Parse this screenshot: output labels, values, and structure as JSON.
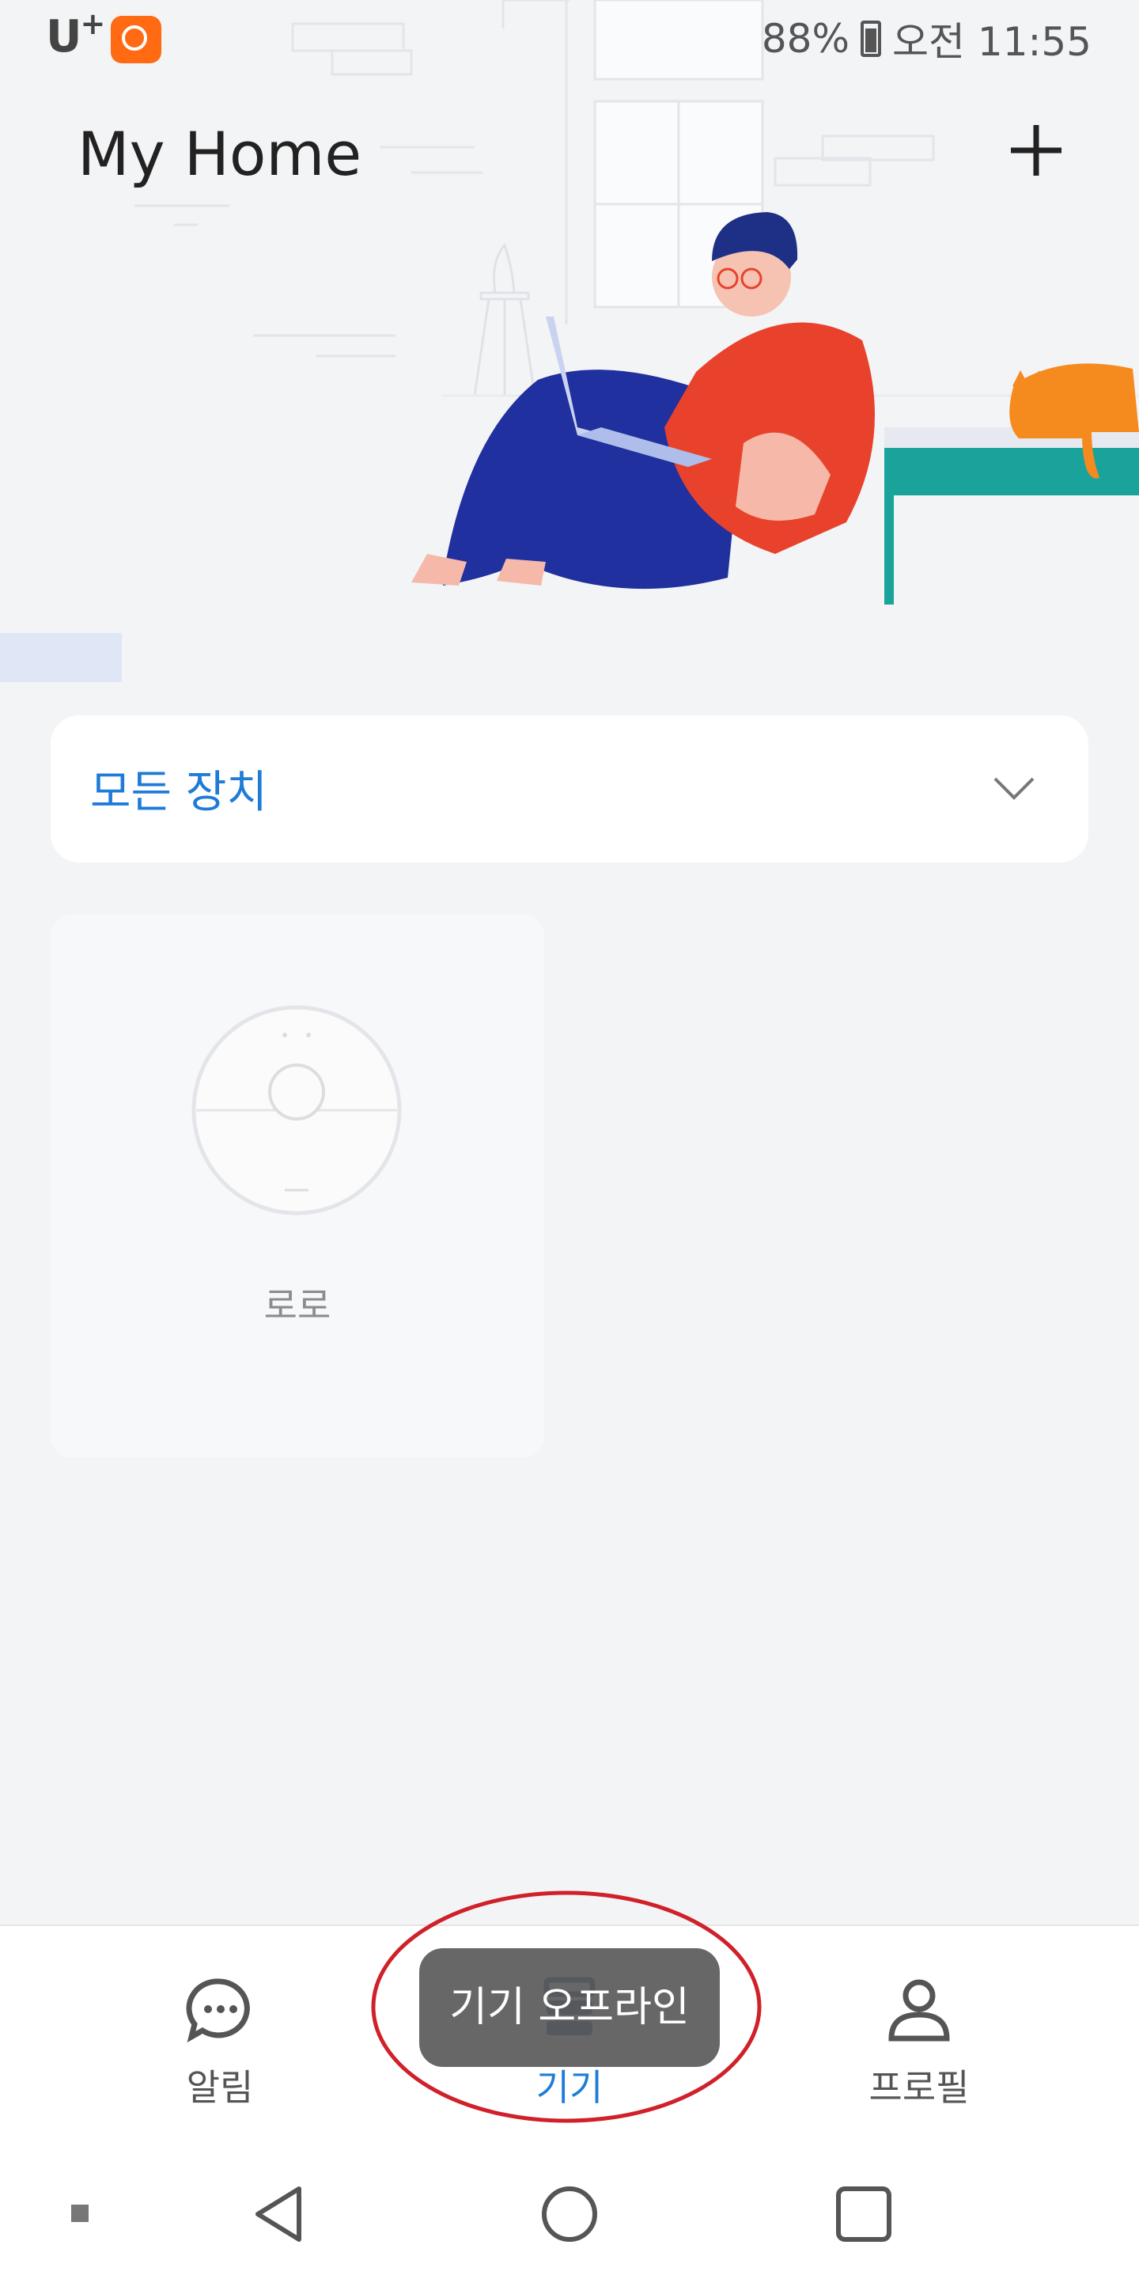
{
  "status_bar": {
    "carrier": "U",
    "carrier_sup": "+",
    "battery": "88%",
    "time": "오전 11:55",
    "icons": [
      "xiaomi-home-app-icon",
      "bluetooth-icon",
      "lte-icon",
      "signal-icon",
      "battery-icon"
    ]
  },
  "header": {
    "title": "My Home",
    "add_icon": "plus-icon"
  },
  "filter": {
    "label": "모든 장치",
    "icon": "chevron-down-icon"
  },
  "devices": [
    {
      "name": "로로",
      "icon": "robot-vacuum-icon",
      "status": "offline"
    }
  ],
  "bottom_nav": {
    "items": [
      {
        "label": "알림",
        "icon": "chat-bubble-icon",
        "active": false
      },
      {
        "label": "기기",
        "icon": "device-icon",
        "active": true
      },
      {
        "label": "프로필",
        "icon": "profile-icon",
        "active": false
      }
    ]
  },
  "toast": {
    "text": "기기 오프라인"
  },
  "colors": {
    "accent": "#1f7bd8",
    "background": "#f3f4f6",
    "toast_bg": "#5a5a5a",
    "annotation": "#d0202a",
    "mi_orange": "#ff6a13"
  }
}
